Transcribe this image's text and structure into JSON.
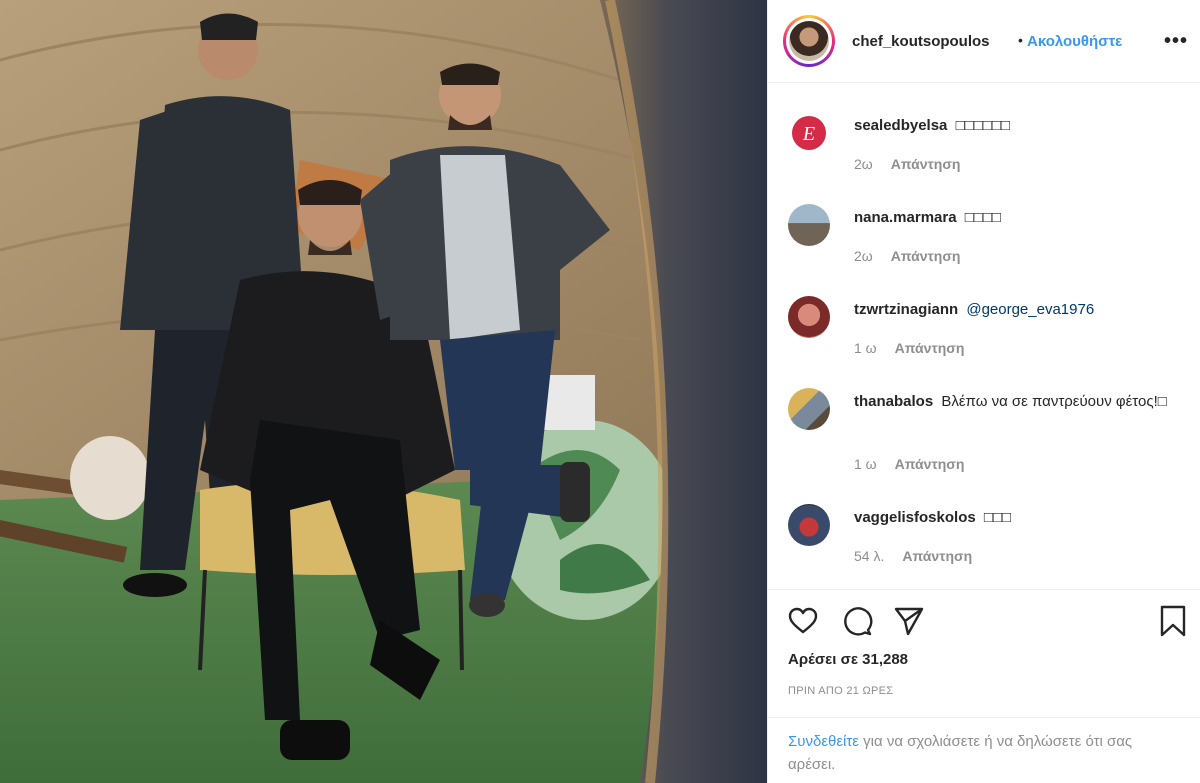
{
  "post": {
    "author": "chef_koutsopoulos",
    "dot": "•",
    "follow_label": "Ακολουθήστε",
    "more_label": "•••"
  },
  "comments": [
    {
      "user": "sealedbyelsa",
      "text": "□□□□□□",
      "mention": "",
      "time": "2ω",
      "reply_label": "Απάντηση"
    },
    {
      "user": "nana.marmara",
      "text": "□□□□",
      "mention": "",
      "time": "2ω",
      "reply_label": "Απάντηση"
    },
    {
      "user": "tzwrtzinagiann",
      "text": "",
      "mention": "@george_eva1976",
      "time": "1 ω",
      "reply_label": "Απάντηση"
    },
    {
      "user": "thanabalos",
      "text": "Βλέπω να σε παντρεύουν φέτος!□",
      "mention": "",
      "time": "1 ω",
      "reply_label": "Απάντηση"
    },
    {
      "user": "vaggelisfoskolos",
      "text": "□□□",
      "mention": "",
      "time": "54 λ.",
      "reply_label": "Απάντηση"
    }
  ],
  "actions": {
    "like_icon": "heart-icon",
    "comment_icon": "comment-bubble-icon",
    "share_icon": "paper-plane-icon",
    "save_icon": "bookmark-icon",
    "likes_text": "Αρέσει σε 31,288",
    "timestamp": "ΠΡΙΝ ΑΠΟ 21 ΩΡΕΣ"
  },
  "login_prompt": {
    "link": "Συνδεθείτε",
    "rest": " για να σχολιάσετε ή να δηλώσετε ότι σας αρέσει."
  }
}
